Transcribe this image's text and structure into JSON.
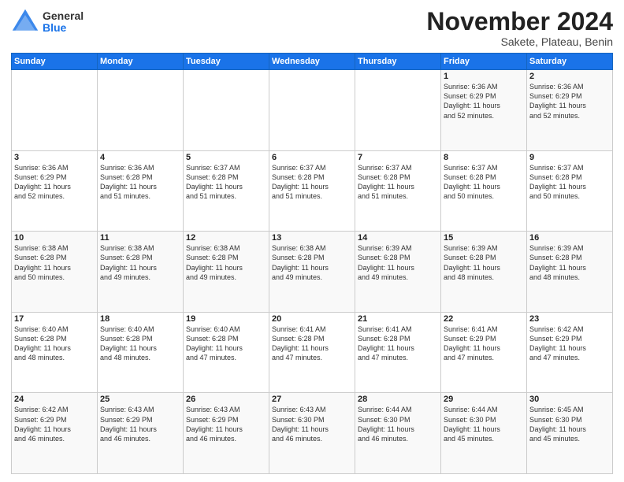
{
  "logo": {
    "general": "General",
    "blue": "Blue"
  },
  "title": "November 2024",
  "subtitle": "Sakete, Plateau, Benin",
  "days_of_week": [
    "Sunday",
    "Monday",
    "Tuesday",
    "Wednesday",
    "Thursday",
    "Friday",
    "Saturday"
  ],
  "weeks": [
    [
      {
        "day": "",
        "info": ""
      },
      {
        "day": "",
        "info": ""
      },
      {
        "day": "",
        "info": ""
      },
      {
        "day": "",
        "info": ""
      },
      {
        "day": "",
        "info": ""
      },
      {
        "day": "1",
        "info": "Sunrise: 6:36 AM\nSunset: 6:29 PM\nDaylight: 11 hours\nand 52 minutes."
      },
      {
        "day": "2",
        "info": "Sunrise: 6:36 AM\nSunset: 6:29 PM\nDaylight: 11 hours\nand 52 minutes."
      }
    ],
    [
      {
        "day": "3",
        "info": "Sunrise: 6:36 AM\nSunset: 6:29 PM\nDaylight: 11 hours\nand 52 minutes."
      },
      {
        "day": "4",
        "info": "Sunrise: 6:36 AM\nSunset: 6:28 PM\nDaylight: 11 hours\nand 51 minutes."
      },
      {
        "day": "5",
        "info": "Sunrise: 6:37 AM\nSunset: 6:28 PM\nDaylight: 11 hours\nand 51 minutes."
      },
      {
        "day": "6",
        "info": "Sunrise: 6:37 AM\nSunset: 6:28 PM\nDaylight: 11 hours\nand 51 minutes."
      },
      {
        "day": "7",
        "info": "Sunrise: 6:37 AM\nSunset: 6:28 PM\nDaylight: 11 hours\nand 51 minutes."
      },
      {
        "day": "8",
        "info": "Sunrise: 6:37 AM\nSunset: 6:28 PM\nDaylight: 11 hours\nand 50 minutes."
      },
      {
        "day": "9",
        "info": "Sunrise: 6:37 AM\nSunset: 6:28 PM\nDaylight: 11 hours\nand 50 minutes."
      }
    ],
    [
      {
        "day": "10",
        "info": "Sunrise: 6:38 AM\nSunset: 6:28 PM\nDaylight: 11 hours\nand 50 minutes."
      },
      {
        "day": "11",
        "info": "Sunrise: 6:38 AM\nSunset: 6:28 PM\nDaylight: 11 hours\nand 49 minutes."
      },
      {
        "day": "12",
        "info": "Sunrise: 6:38 AM\nSunset: 6:28 PM\nDaylight: 11 hours\nand 49 minutes."
      },
      {
        "day": "13",
        "info": "Sunrise: 6:38 AM\nSunset: 6:28 PM\nDaylight: 11 hours\nand 49 minutes."
      },
      {
        "day": "14",
        "info": "Sunrise: 6:39 AM\nSunset: 6:28 PM\nDaylight: 11 hours\nand 49 minutes."
      },
      {
        "day": "15",
        "info": "Sunrise: 6:39 AM\nSunset: 6:28 PM\nDaylight: 11 hours\nand 48 minutes."
      },
      {
        "day": "16",
        "info": "Sunrise: 6:39 AM\nSunset: 6:28 PM\nDaylight: 11 hours\nand 48 minutes."
      }
    ],
    [
      {
        "day": "17",
        "info": "Sunrise: 6:40 AM\nSunset: 6:28 PM\nDaylight: 11 hours\nand 48 minutes."
      },
      {
        "day": "18",
        "info": "Sunrise: 6:40 AM\nSunset: 6:28 PM\nDaylight: 11 hours\nand 48 minutes."
      },
      {
        "day": "19",
        "info": "Sunrise: 6:40 AM\nSunset: 6:28 PM\nDaylight: 11 hours\nand 47 minutes."
      },
      {
        "day": "20",
        "info": "Sunrise: 6:41 AM\nSunset: 6:28 PM\nDaylight: 11 hours\nand 47 minutes."
      },
      {
        "day": "21",
        "info": "Sunrise: 6:41 AM\nSunset: 6:28 PM\nDaylight: 11 hours\nand 47 minutes."
      },
      {
        "day": "22",
        "info": "Sunrise: 6:41 AM\nSunset: 6:29 PM\nDaylight: 11 hours\nand 47 minutes."
      },
      {
        "day": "23",
        "info": "Sunrise: 6:42 AM\nSunset: 6:29 PM\nDaylight: 11 hours\nand 47 minutes."
      }
    ],
    [
      {
        "day": "24",
        "info": "Sunrise: 6:42 AM\nSunset: 6:29 PM\nDaylight: 11 hours\nand 46 minutes."
      },
      {
        "day": "25",
        "info": "Sunrise: 6:43 AM\nSunset: 6:29 PM\nDaylight: 11 hours\nand 46 minutes."
      },
      {
        "day": "26",
        "info": "Sunrise: 6:43 AM\nSunset: 6:29 PM\nDaylight: 11 hours\nand 46 minutes."
      },
      {
        "day": "27",
        "info": "Sunrise: 6:43 AM\nSunset: 6:30 PM\nDaylight: 11 hours\nand 46 minutes."
      },
      {
        "day": "28",
        "info": "Sunrise: 6:44 AM\nSunset: 6:30 PM\nDaylight: 11 hours\nand 46 minutes."
      },
      {
        "day": "29",
        "info": "Sunrise: 6:44 AM\nSunset: 6:30 PM\nDaylight: 11 hours\nand 45 minutes."
      },
      {
        "day": "30",
        "info": "Sunrise: 6:45 AM\nSunset: 6:30 PM\nDaylight: 11 hours\nand 45 minutes."
      }
    ]
  ]
}
